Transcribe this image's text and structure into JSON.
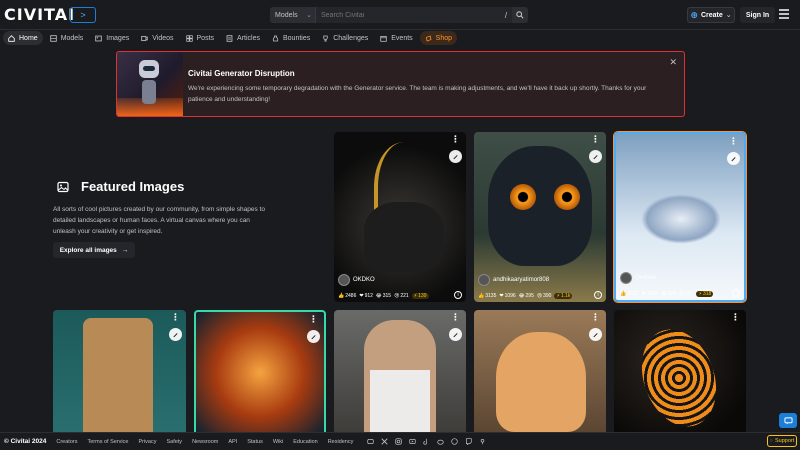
{
  "header": {
    "logo_prefix": "CIVIT",
    "logo_suffix": "AI",
    "logo_badge": ">",
    "search_type": "Models",
    "search_placeholder": "Search Civitai",
    "search_shortcut": "/",
    "create_label": "Create",
    "signin_label": "Sign In"
  },
  "nav": {
    "items": [
      {
        "label": "Home",
        "icon": "home-icon"
      },
      {
        "label": "Models",
        "icon": "layers-icon"
      },
      {
        "label": "Images",
        "icon": "image-icon"
      },
      {
        "label": "Videos",
        "icon": "video-icon"
      },
      {
        "label": "Posts",
        "icon": "grid-icon"
      },
      {
        "label": "Articles",
        "icon": "article-icon"
      },
      {
        "label": "Bounties",
        "icon": "moneybag-icon"
      },
      {
        "label": "Challenges",
        "icon": "trophy-icon"
      },
      {
        "label": "Events",
        "icon": "calendar-icon"
      },
      {
        "label": "Shop",
        "icon": "shopping-bag-icon"
      }
    ]
  },
  "banner": {
    "title": "Civitai Generator Disruption",
    "text": "We're experiencing some temporary degradation with the Generator service. The team is making adjustments, and we'll have it back up shortly. Thanks for your patience and understanding!"
  },
  "featured": {
    "title": "Featured Images",
    "description": "All sorts of cool pictures created by our community, from simple shapes to detailed landscapes or human faces. A virtual canvas where you can unleash your creativity or get inspired.",
    "explore_label": "Explore all images"
  },
  "cards": [
    {
      "user": "OKDKO",
      "likes": "2486",
      "hearts": "912",
      "laughs": "315",
      "cries": "221",
      "buzz": "139"
    },
    {
      "user": "andhikaaryatimor808",
      "likes": "3135",
      "hearts": "1096",
      "laughs": "295",
      "cries": "390",
      "buzz": "1.1k"
    },
    {
      "user": "Qvohsu",
      "likes": "3022",
      "hearts": "1053",
      "laughs": "324",
      "cries": "227",
      "buzz": "318"
    }
  ],
  "footer": {
    "copyright": "© Civitai 2024",
    "links": [
      "Creators",
      "Terms of Service",
      "Privacy",
      "Safety",
      "Newsroom",
      "API",
      "Status",
      "Wiki",
      "Education",
      "Residency"
    ],
    "support_label": "Support"
  },
  "colors": {
    "accent": "#1c7ed6",
    "banner_border": "#e03131",
    "buzz": "#fcc419",
    "shop": "#ff922b"
  }
}
